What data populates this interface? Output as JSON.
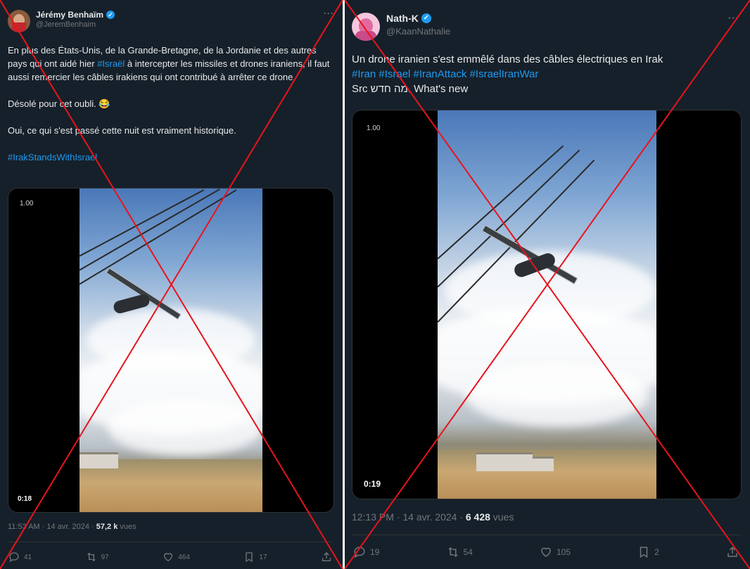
{
  "left": {
    "author": {
      "name": "Jérémy Benhaïm",
      "handle": "@JeremBenhaim"
    },
    "more": "···",
    "text": {
      "p1_a": "En plus des États-Unis, de la Grande-Bretagne, de la Jordanie et des autres pays qui ont aidé hier ",
      "p1_tag": "#Israël",
      "p1_b": " à intercepter les missiles et drones iraniens, il faut aussi remercier les câbles irakiens qui ont contribué à arrêter ce drone.",
      "p2": "Désolé pour cet oubli. 😂",
      "p3": "Oui, ce qui s'est passé cette nuit est vraiment historique.",
      "p4_tag": "#IrakStandsWithIsrael"
    },
    "video": {
      "overlay_time": "1.00",
      "duration": "0:18"
    },
    "meta": {
      "time_date": "11:53 AM · 14 avr. 2024 · ",
      "views_count": "57,2 k",
      "views_label": " vues"
    },
    "actions": {
      "replies": "41",
      "reposts": "97",
      "likes": "464",
      "bookmarks": "17"
    }
  },
  "right": {
    "author": {
      "name": "Nath-K",
      "handle": "@KaanNathalie"
    },
    "more": "···",
    "text": {
      "line1": "Un drone iranien s'est emmêlé dans des câbles électriques en Irak",
      "tags": "#Iran #Israel #IranAttack #IsraelIranWar",
      "src": "Src מה חדש. What's new"
    },
    "video": {
      "overlay_time": "1.00",
      "duration": "0:19"
    },
    "meta": {
      "time_date": "12:13 PM · 14 avr. 2024 · ",
      "views_count": "6 428",
      "views_label": " vues"
    },
    "actions": {
      "replies": "19",
      "reposts": "54",
      "likes": "105",
      "bookmarks": "2"
    }
  },
  "colors": {
    "background": "#16202a",
    "text": "#e7e9ea",
    "muted": "#71767b",
    "link": "#1d9bf0",
    "cross": "#e8141c"
  }
}
